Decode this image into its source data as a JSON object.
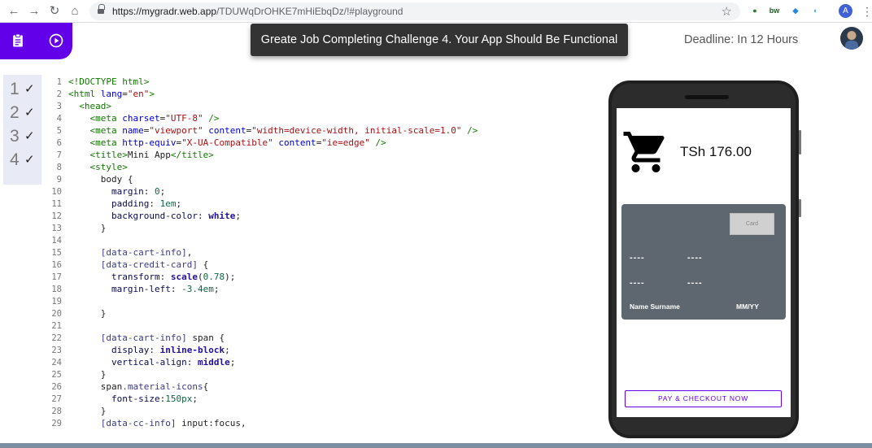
{
  "browser": {
    "url_host": "https://mygradr.web.app",
    "url_path": "/TDUWqDrOHKE7mHiEbqDz/!#playground",
    "back_icon": "arrow-left",
    "forward_icon": "arrow-right",
    "reload_icon": "reload",
    "home_icon": "home",
    "bookmark_icon": "star",
    "extensions": [
      {
        "name": "globe-extension-icon",
        "glyph": "●",
        "color": "#2e7d32"
      },
      {
        "name": "bw-extension-icon",
        "glyph": "bw",
        "color": "#1b5e20"
      },
      {
        "name": "dropbox-extension-icon",
        "glyph": "◆",
        "color": "#1e88e5"
      },
      {
        "name": "drop-extension-icon",
        "glyph": "◐",
        "color": "#42a5f5"
      }
    ],
    "profile_initial": "A"
  },
  "header": {
    "challenge_banner": "Greate Job Completing Challenge 4. Your App Should Be Functional",
    "deadline": "Deadline: In 12 Hours",
    "tab_icons": [
      "clipboard-icon",
      "play-circle-icon"
    ]
  },
  "progress": {
    "items": [
      {
        "number": "1",
        "check": "✓"
      },
      {
        "number": "2",
        "check": "✓"
      },
      {
        "number": "3",
        "check": "✓"
      },
      {
        "number": "4",
        "check": "✓"
      }
    ]
  },
  "editor": {
    "lines": [
      [
        [
          "t-tag",
          "<!DOCTYPE html>"
        ]
      ],
      [
        [
          "t-tag",
          "<html"
        ],
        [
          "t-attr",
          " lang"
        ],
        [
          "t-dark",
          "="
        ],
        [
          "t-str",
          "\"en\""
        ],
        [
          "t-tag",
          ">"
        ]
      ],
      [
        [
          "t-dark",
          "  "
        ],
        [
          "t-tag",
          "<head>"
        ]
      ],
      [
        [
          "t-dark",
          "    "
        ],
        [
          "t-tag",
          "<meta"
        ],
        [
          "t-attr",
          " charset"
        ],
        [
          "t-dark",
          "="
        ],
        [
          "t-str",
          "\"UTF-8\""
        ],
        [
          "t-tag",
          " />"
        ]
      ],
      [
        [
          "t-dark",
          "    "
        ],
        [
          "t-tag",
          "<meta"
        ],
        [
          "t-attr",
          " name"
        ],
        [
          "t-dark",
          "="
        ],
        [
          "t-str",
          "\"viewport\""
        ],
        [
          "t-attr",
          " content"
        ],
        [
          "t-dark",
          "="
        ],
        [
          "t-str",
          "\"width=device-width, initial-scale=1.0\""
        ],
        [
          "t-tag",
          " />"
        ]
      ],
      [
        [
          "t-dark",
          "    "
        ],
        [
          "t-tag",
          "<meta"
        ],
        [
          "t-attr",
          " http-equiv"
        ],
        [
          "t-dark",
          "="
        ],
        [
          "t-str",
          "\"X-UA-Compatible\""
        ],
        [
          "t-attr",
          " content"
        ],
        [
          "t-dark",
          "="
        ],
        [
          "t-str",
          "\"ie=edge\""
        ],
        [
          "t-tag",
          " />"
        ]
      ],
      [
        [
          "t-dark",
          "    "
        ],
        [
          "t-tag",
          "<title>"
        ],
        [
          "t-dark",
          "Mini App"
        ],
        [
          "t-tag",
          "</title>"
        ]
      ],
      [
        [
          "t-dark",
          "    "
        ],
        [
          "t-tag",
          "<style>"
        ]
      ],
      [
        [
          "t-dark",
          "      body {"
        ]
      ],
      [
        [
          "t-dark",
          "        "
        ],
        [
          "t-prop",
          "margin"
        ],
        [
          "t-dark",
          ": "
        ],
        [
          "t-num",
          "0"
        ],
        [
          "t-dark",
          ";"
        ]
      ],
      [
        [
          "t-dark",
          "        "
        ],
        [
          "t-prop",
          "padding"
        ],
        [
          "t-dark",
          ": "
        ],
        [
          "t-num",
          "1em"
        ],
        [
          "t-dark",
          ";"
        ]
      ],
      [
        [
          "t-dark",
          "        "
        ],
        [
          "t-prop",
          "background-color"
        ],
        [
          "t-dark",
          ": "
        ],
        [
          "t-kw",
          "white"
        ],
        [
          "t-dark",
          ";"
        ]
      ],
      [
        [
          "t-dark",
          "      }"
        ]
      ],
      [
        [
          "t-dark",
          ""
        ]
      ],
      [
        [
          "t-dark",
          "      "
        ],
        [
          "t-sel",
          "[data-cart-info]"
        ],
        [
          "t-dark",
          ","
        ]
      ],
      [
        [
          "t-dark",
          "      "
        ],
        [
          "t-sel",
          "[data-credit-card]"
        ],
        [
          "t-dark",
          " {"
        ]
      ],
      [
        [
          "t-dark",
          "        "
        ],
        [
          "t-prop",
          "transform"
        ],
        [
          "t-dark",
          ": "
        ],
        [
          "t-kw",
          "scale"
        ],
        [
          "t-dark",
          "("
        ],
        [
          "t-num",
          "0.78"
        ],
        [
          "t-dark",
          ");"
        ]
      ],
      [
        [
          "t-dark",
          "        "
        ],
        [
          "t-prop",
          "margin-left"
        ],
        [
          "t-dark",
          ": "
        ],
        [
          "t-num",
          "-3.4em"
        ],
        [
          "t-dark",
          ";"
        ]
      ],
      [
        [
          "t-dark",
          ""
        ]
      ],
      [
        [
          "t-dark",
          "      }"
        ]
      ],
      [
        [
          "t-dark",
          ""
        ]
      ],
      [
        [
          "t-dark",
          "      "
        ],
        [
          "t-sel",
          "[data-cart-info]"
        ],
        [
          "t-dark",
          " span {"
        ]
      ],
      [
        [
          "t-dark",
          "        "
        ],
        [
          "t-prop",
          "display"
        ],
        [
          "t-dark",
          ": "
        ],
        [
          "t-kw",
          "inline-block"
        ],
        [
          "t-dark",
          ";"
        ]
      ],
      [
        [
          "t-dark",
          "        "
        ],
        [
          "t-prop",
          "vertical-align"
        ],
        [
          "t-dark",
          ": "
        ],
        [
          "t-kw",
          "middle"
        ],
        [
          "t-dark",
          ";"
        ]
      ],
      [
        [
          "t-dark",
          "      }"
        ]
      ],
      [
        [
          "t-dark",
          "      span"
        ],
        [
          "t-sel",
          ".material-icons"
        ],
        [
          "t-dark",
          "{"
        ]
      ],
      [
        [
          "t-dark",
          "        "
        ],
        [
          "t-prop",
          "font-size"
        ],
        [
          "t-dark",
          ":"
        ],
        [
          "t-num",
          "150px"
        ],
        [
          "t-dark",
          ";"
        ]
      ],
      [
        [
          "t-dark",
          "      }"
        ]
      ],
      [
        [
          "t-dark",
          "      "
        ],
        [
          "t-sel",
          "[data-cc-info]"
        ],
        [
          "t-dark",
          " input:focus,"
        ]
      ]
    ]
  },
  "preview": {
    "cart_icon": "shopping-cart-icon",
    "total": "TSh 176.00",
    "card": {
      "type_label": "Card",
      "number_segments": [
        "----",
        "----",
        "----",
        "----"
      ],
      "name": "Name Surname",
      "expiry": "MM/YY"
    },
    "pay_button": "PAY & CHECKOUT NOW"
  }
}
